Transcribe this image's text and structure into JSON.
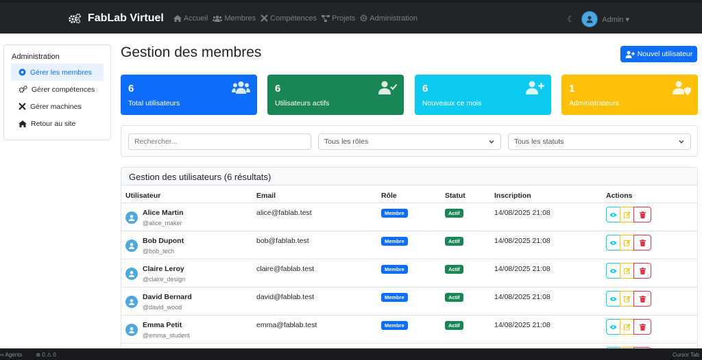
{
  "navbar": {
    "brand": "FabLab Virtuel",
    "links": [
      {
        "label": "Accueil",
        "icon": "home-icon"
      },
      {
        "label": "Membres",
        "icon": "users-icon"
      },
      {
        "label": "Compétences",
        "icon": "tools-icon"
      },
      {
        "label": "Projets",
        "icon": "project-diagram-icon"
      },
      {
        "label": "Administration",
        "icon": "gear-icon"
      }
    ],
    "user_label": "Admin"
  },
  "sidebar": {
    "title": "Administration",
    "items": [
      {
        "label": "Gérer les membres",
        "icon": "user-cog-icon",
        "active": true
      },
      {
        "label": "Gérer compétences",
        "icon": "cogs-icon",
        "active": false
      },
      {
        "label": "Gérer machines",
        "icon": "tools-icon",
        "active": false
      },
      {
        "label": "Retour au site",
        "icon": "home-icon",
        "active": false
      }
    ]
  },
  "page": {
    "title": "Gestion des membres",
    "new_user_button": "Nouvel utilisateur"
  },
  "stats": [
    {
      "value": "6",
      "label": "Total utilisateurs",
      "color": "#0d6efd",
      "icon": "users-icon"
    },
    {
      "value": "6",
      "label": "Utilisateurs actifs",
      "color": "#198754",
      "icon": "user-check-icon"
    },
    {
      "value": "6",
      "label": "Nouveaux ce mois",
      "color": "#0dcaf0",
      "icon": "user-plus-icon"
    },
    {
      "value": "1",
      "label": "Administrateurs",
      "color": "#ffc107",
      "icon": "user-shield-icon"
    }
  ],
  "filters": {
    "search_placeholder": "Rechercher...",
    "role_select": "Tous les rôles",
    "status_select": "Tous les statuts"
  },
  "table": {
    "title": "Gestion des utilisateurs (6 résultats)",
    "columns": [
      "Utilisateur",
      "Email",
      "Rôle",
      "Statut",
      "Inscription",
      "Actions"
    ],
    "rows": [
      {
        "name": "Alice Martin",
        "handle": "@alice_maker",
        "email": "alice@fablab.test",
        "role": "Membre",
        "status": "Actif",
        "date": "14/08/2025 21:08"
      },
      {
        "name": "Bob Dupont",
        "handle": "@bob_tech",
        "email": "bob@fablab.test",
        "role": "Membre",
        "status": "Actif",
        "date": "14/08/2025 21:08"
      },
      {
        "name": "Claire Leroy",
        "handle": "@claire_design",
        "email": "claire@fablab.test",
        "role": "Membre",
        "status": "Actif",
        "date": "14/08/2025 21:08"
      },
      {
        "name": "David Bernard",
        "handle": "@david_wood",
        "email": "david@fablab.test",
        "role": "Membre",
        "status": "Actif",
        "date": "14/08/2025 21:08"
      },
      {
        "name": "Emma Petit",
        "handle": "@emma_student",
        "email": "emma@fablab.test",
        "role": "Membre",
        "status": "Actif",
        "date": "14/08/2025 21:08"
      }
    ]
  },
  "statusbar": {
    "agents": "Agents",
    "problems": "0 ⚠ 0",
    "right": "Cursor Tab"
  }
}
